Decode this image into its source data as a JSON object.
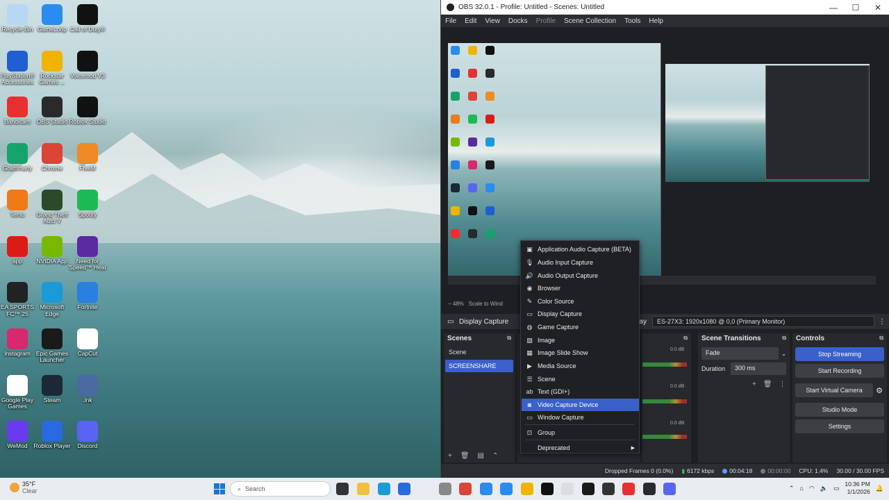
{
  "desktop": {
    "icons": [
      {
        "label": "Recycle Bin",
        "color": "#b8d7f2"
      },
      {
        "label": "GameLoop",
        "color": "#2a8cf0"
      },
      {
        "label": "Call of Duty®",
        "color": "#111111"
      },
      {
        "label": "PlayStation® Accessories",
        "color": "#1f5fd1"
      },
      {
        "label": "Rockstar Games ...",
        "color": "#f0b400"
      },
      {
        "label": "Voicemod V3",
        "color": "#111111"
      },
      {
        "label": "Bandicam",
        "color": "#e83030"
      },
      {
        "label": "OBS Studio",
        "color": "#2a2a2a"
      },
      {
        "label": "Roblox Studio",
        "color": "#111111"
      },
      {
        "label": "Grammarly",
        "color": "#15a36b"
      },
      {
        "label": "Chrome",
        "color": "#db4437"
      },
      {
        "label": "FiveM",
        "color": "#f08a24"
      },
      {
        "label": "Temu",
        "color": "#f07a18"
      },
      {
        "label": "Grand Theft Auto V",
        "color": "#2a4a2a"
      },
      {
        "label": "Spotify",
        "color": "#1db954"
      },
      {
        "label": "app",
        "color": "#dd1b16"
      },
      {
        "label": "NVIDIA App",
        "color": "#76b900"
      },
      {
        "label": "Need for Speed™ Heat",
        "color": "#5a2aa0"
      },
      {
        "label": "EA SPORTS FC™ 25",
        "color": "#222222"
      },
      {
        "label": "Microsoft Edge",
        "color": "#1b9ad8"
      },
      {
        "label": "Fortnite",
        "color": "#2a7fe0"
      },
      {
        "label": "Instagram",
        "color": "#d6296e"
      },
      {
        "label": "Epic Games Launcher",
        "color": "#1a1a1a"
      },
      {
        "label": "CapCut",
        "color": "#ffffff"
      },
      {
        "label": "Google Play Games",
        "color": "#ffffff"
      },
      {
        "label": "Steam",
        "color": "#1b2838"
      },
      {
        "label": ".lnk",
        "color": "#4a6aa0"
      },
      {
        "label": "WeMod",
        "color": "#6a3af0"
      },
      {
        "label": "Roblox Player",
        "color": "#2a6ae0"
      },
      {
        "label": "Discord",
        "color": "#5865f2"
      }
    ]
  },
  "obs": {
    "title": "OBS 32.0.1 - Profile: Untitled - Scenes: Untitled",
    "window_controls": {
      "minimize": "—",
      "maximize": "☐",
      "close": "✕"
    },
    "menu": [
      "File",
      "Edit",
      "View",
      "Docks",
      "Profile",
      "Scene Collection",
      "Tools",
      "Help"
    ],
    "zoom": "48%",
    "scale_label": "Scale to Wind",
    "source_bar": {
      "label": "Display Capture",
      "display_label": "play",
      "display_value": "ES-27X3: 1920x1080 @ 0,0 (Primary Monitor)"
    },
    "scenes": {
      "title": "Scenes",
      "items": [
        "Scene",
        "SCREENSHARE"
      ]
    },
    "mixer": {
      "db": [
        "0.0 dB",
        "0.0 dB",
        "0.0 dB"
      ]
    },
    "transitions": {
      "title": "Scene Transitions",
      "type": "Fade",
      "duration_label": "Duration",
      "duration_value": "300 ms"
    },
    "controls": {
      "title": "Controls",
      "buttons": [
        "Stop Streaming",
        "Start Recording",
        "Start Virtual Camera",
        "Studio Mode",
        "Settings"
      ]
    },
    "status": {
      "dropped": "Dropped Frames 0 (0.0%)",
      "bitrate": "6172 kbps",
      "stream_time": "00:04:18",
      "rec_time": "00:00:00",
      "cpu": "CPU: 1.4%",
      "fps": "30.00 / 30.00 FPS"
    }
  },
  "context_menu": {
    "items": [
      {
        "label": "Application Audio Capture (BETA)",
        "icon": "app-audio-icon",
        "glyph": "▣"
      },
      {
        "label": "Audio Input Capture",
        "icon": "microphone-icon",
        "glyph": "🎙"
      },
      {
        "label": "Audio Output Capture",
        "icon": "speaker-icon",
        "glyph": "🔊"
      },
      {
        "label": "Browser",
        "icon": "globe-icon",
        "glyph": "◉"
      },
      {
        "label": "Color Source",
        "icon": "brush-icon",
        "glyph": "✎"
      },
      {
        "label": "Display Capture",
        "icon": "monitor-icon",
        "glyph": "▭"
      },
      {
        "label": "Game Capture",
        "icon": "gamepad-icon",
        "glyph": "◍"
      },
      {
        "label": "Image",
        "icon": "image-icon",
        "glyph": "▨"
      },
      {
        "label": "Image Slide Show",
        "icon": "slideshow-icon",
        "glyph": "▦"
      },
      {
        "label": "Media Source",
        "icon": "play-icon",
        "glyph": "▶"
      },
      {
        "label": "Scene",
        "icon": "list-icon",
        "glyph": "☰"
      },
      {
        "label": "Text (GDI+)",
        "icon": "text-icon",
        "glyph": "ab"
      },
      {
        "label": "Video Capture Device",
        "icon": "camera-icon",
        "glyph": "◙"
      },
      {
        "label": "Window Capture",
        "icon": "window-icon",
        "glyph": "▭"
      },
      {
        "label": "Group",
        "icon": "group-icon",
        "glyph": "⊡"
      },
      {
        "label": "Deprecated",
        "icon": "",
        "glyph": ""
      }
    ],
    "highlighted_index": 12
  },
  "taskbar": {
    "weather_temp": "35°F",
    "weather_desc": "Clear",
    "search_placeholder": "Search",
    "time": "10:36 PM",
    "date": "1/1/2026"
  }
}
